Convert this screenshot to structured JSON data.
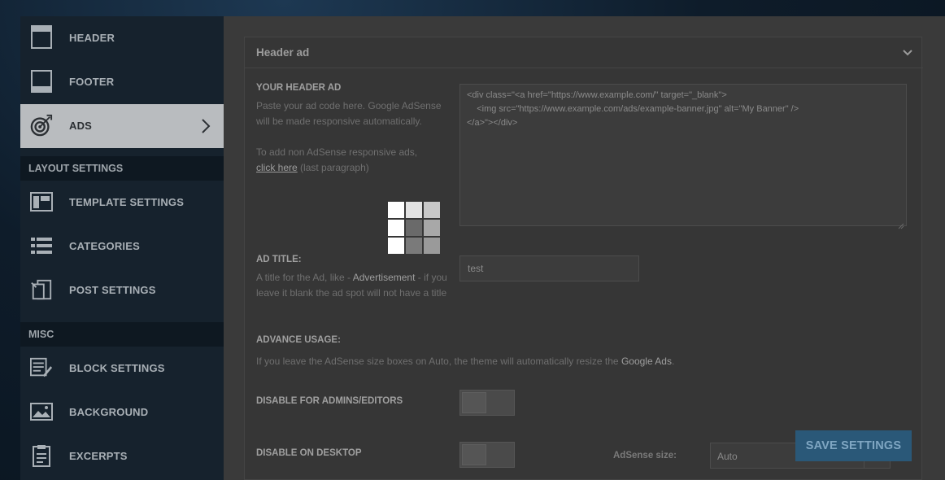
{
  "sidebar": {
    "items": [
      {
        "label": "HEADER",
        "icon": "header-layout-icon"
      },
      {
        "label": "FOOTER",
        "icon": "footer-layout-icon"
      },
      {
        "label": "ADS",
        "icon": "target-icon",
        "active": true
      },
      {
        "label": "TEMPLATE SETTINGS",
        "icon": "template-icon"
      },
      {
        "label": "CATEGORIES",
        "icon": "list-icon"
      },
      {
        "label": "POST SETTINGS",
        "icon": "post-settings-icon"
      },
      {
        "label": "BLOCK SETTINGS",
        "icon": "block-settings-icon"
      },
      {
        "label": "BACKGROUND",
        "icon": "image-icon"
      },
      {
        "label": "EXCERPTS",
        "icon": "clipboard-icon"
      }
    ],
    "sections": [
      {
        "label": "LAYOUT SETTINGS"
      },
      {
        "label": "MISC"
      }
    ]
  },
  "panel": {
    "title": "Header ad",
    "header_ad": {
      "label": "YOUR HEADER AD",
      "desc1": "Paste your ad code here. Google AdSense will be made responsive automatically.",
      "desc2_prefix": "To add non AdSense responsive ads,",
      "desc2_link": "click here",
      "desc2_suffix": "(last paragraph)",
      "code_line1": "<div class=\"<a href=\"https://www.example.com/\" target=\"_blank\">",
      "code_line2": "    <img src=\"https://www.example.com/ads/example-banner.jpg\" alt=\"My Banner\" />",
      "code_line3": "</a>\"></div>"
    },
    "ad_title": {
      "label": "AD TITLE:",
      "desc_prefix": "A title for the Ad, like -",
      "desc_strong": "Advertisement",
      "desc_suffix": "- if you leave it blank the ad spot will not have a title",
      "value": "test"
    },
    "advance": {
      "label": "ADVANCE USAGE:",
      "desc_prefix": "If you leave the AdSense size boxes on Auto, the theme will automatically resize the",
      "desc_strong": "Google Ads",
      "desc_suffix": "."
    },
    "disable_admins": {
      "label": "DISABLE FOR ADMINS/EDITORS"
    },
    "disable_desktop": {
      "label": "DISABLE ON DESKTOP"
    },
    "adsense_size": {
      "label": "AdSense size:",
      "value": "Auto"
    }
  },
  "save_button": {
    "label": "SAVE SETTINGS"
  },
  "colors": {
    "accent": "#2a5878",
    "sidebar_active": "#b9bcbf",
    "overlay": "#3a3a3a"
  }
}
